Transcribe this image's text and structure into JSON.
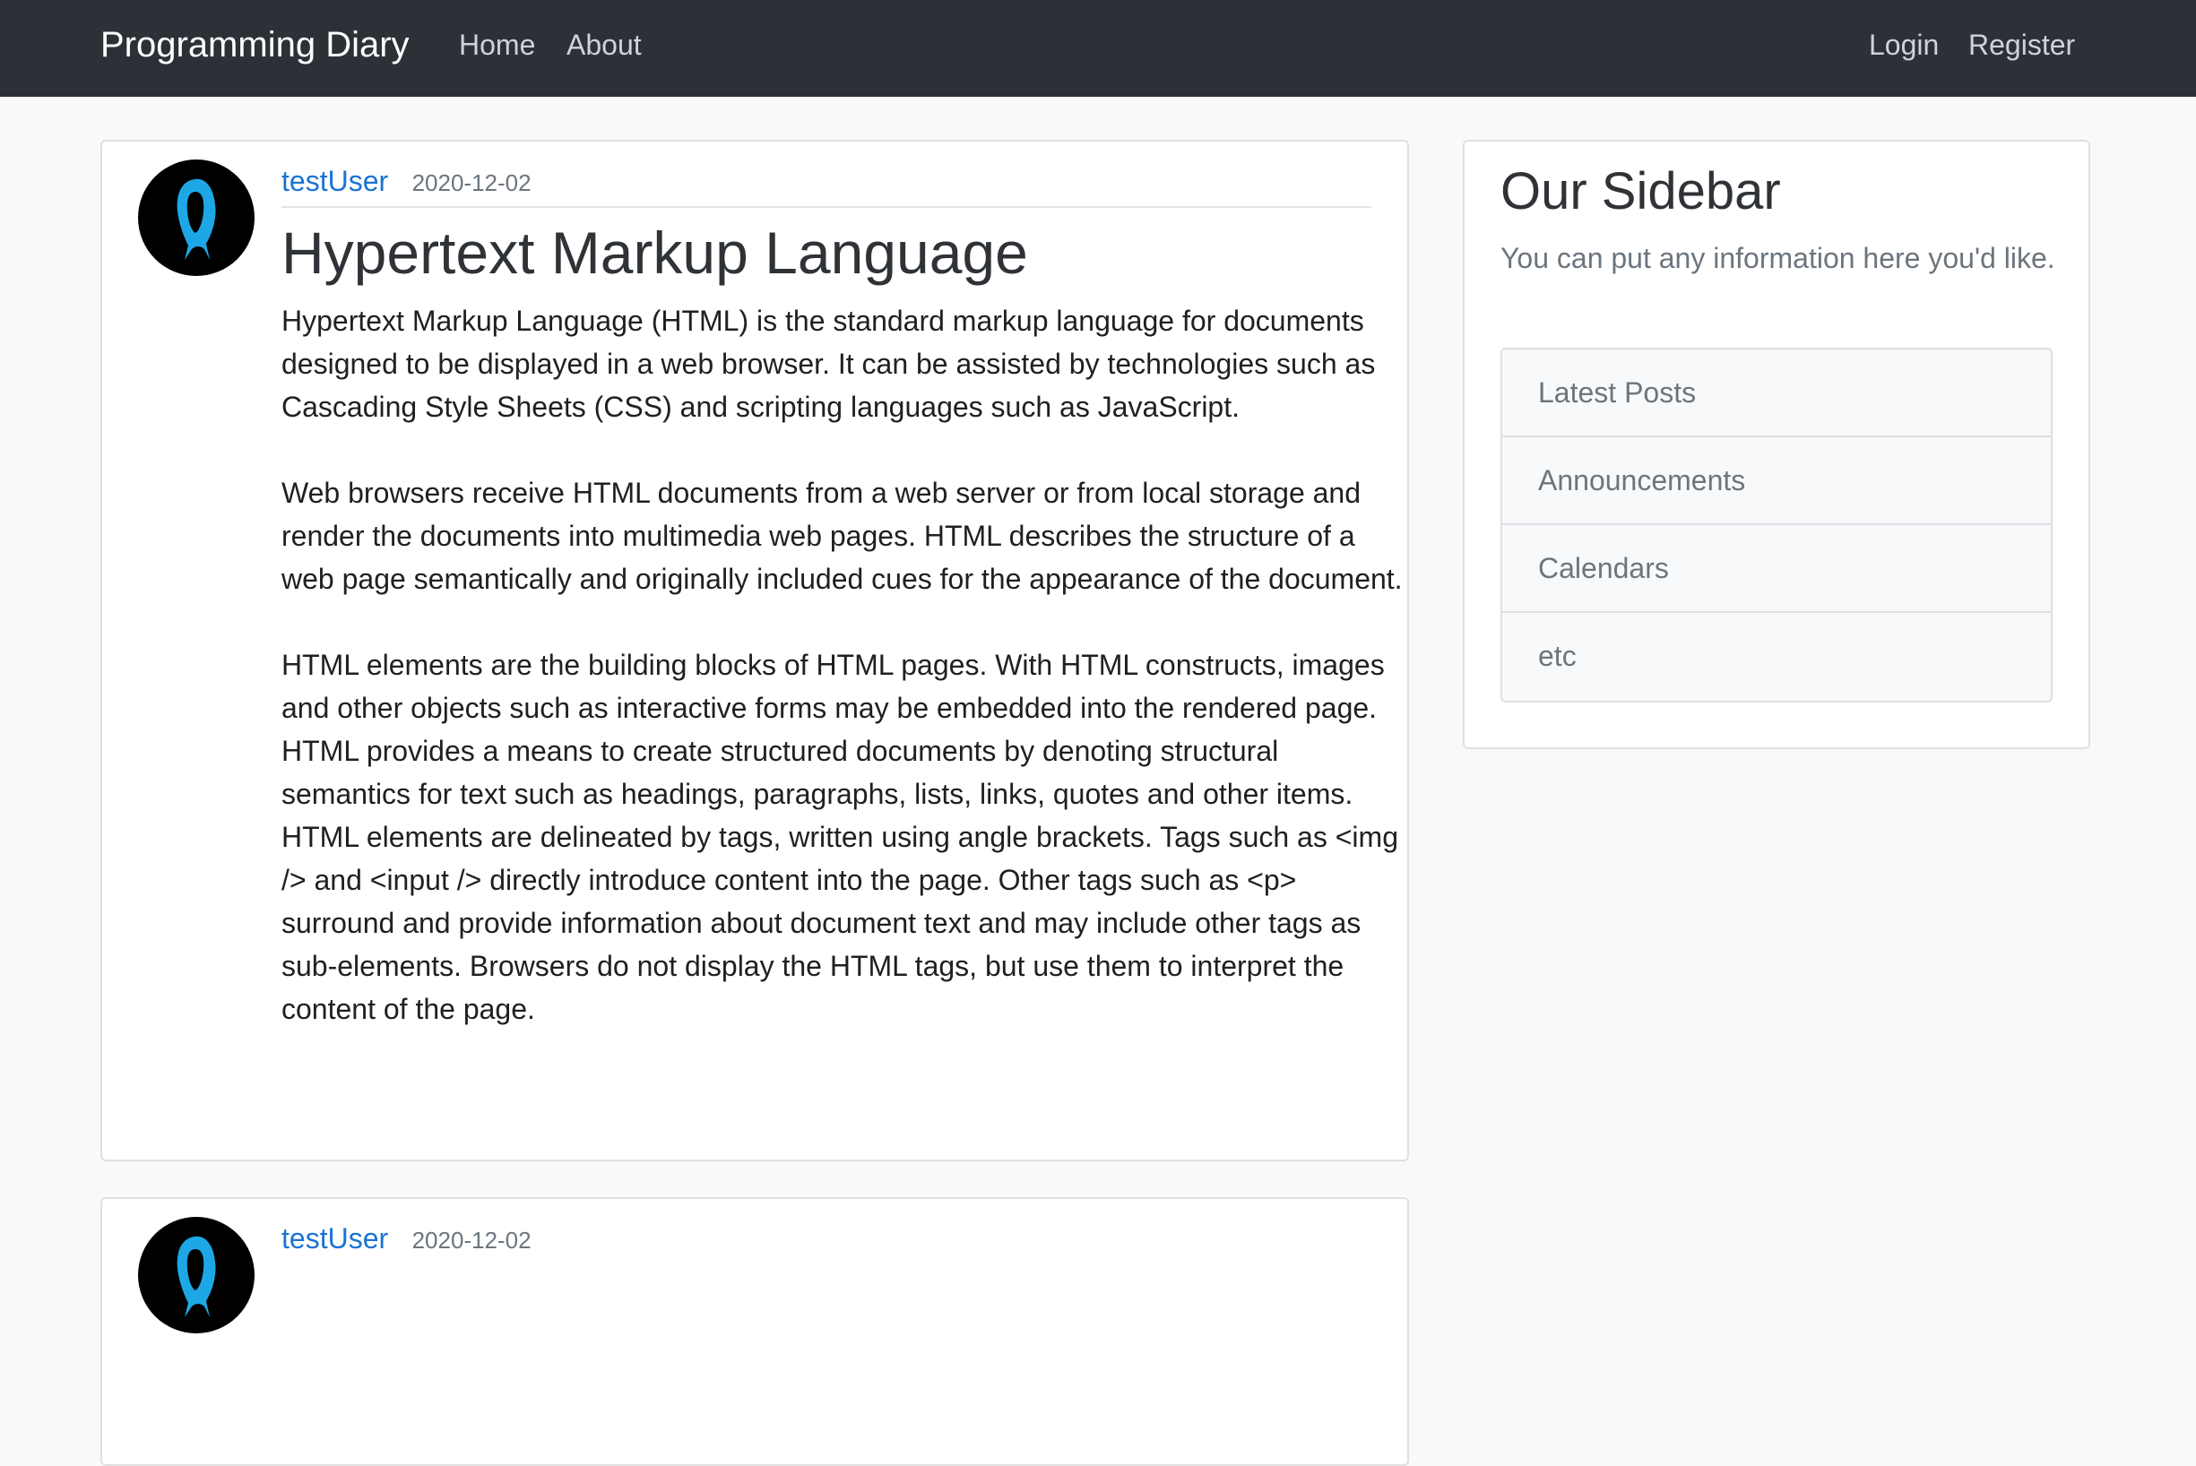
{
  "navbar": {
    "brand": "Programming Diary",
    "links": [
      "Home",
      "About"
    ],
    "auth_links": [
      "Login",
      "Register"
    ]
  },
  "posts": [
    {
      "author": "testUser",
      "date": "2020-12-02",
      "title": "Hypertext Markup Language",
      "paragraphs": [
        "Hypertext Markup Language (HTML) is the standard markup language for documents designed to be displayed in a web browser. It can be assisted by technologies such as Cascading Style Sheets (CSS) and scripting languages such as JavaScript.",
        "Web browsers receive HTML documents from a web server or from local storage and render the documents into multimedia web pages. HTML describes the structure of a web page semantically and originally included cues for the appearance of the document.",
        "HTML elements are the building blocks of HTML pages. With HTML constructs, images and other objects such as interactive forms may be embedded into the rendered page. HTML provides a means to create structured documents by denoting structural semantics for text such as headings, paragraphs, lists, links, quotes and other items. HTML elements are delineated by tags, written using angle brackets. Tags such as <img /> and <input /> directly introduce content into the page. Other tags such as <p> surround and provide information about document text and may include other tags as sub-elements. Browsers do not display the HTML tags, but use them to interpret the content of the page."
      ]
    },
    {
      "author": "testUser",
      "date": "2020-12-02"
    }
  ],
  "sidebar": {
    "title": "Our Sidebar",
    "text": "You can put any information here you'd like.",
    "items": [
      "Latest Posts",
      "Announcements",
      "Calendars",
      "etc"
    ]
  },
  "colors": {
    "navbar": "#2c3138",
    "link": "#1a73d4",
    "avatar_accent": "#1ea7e6"
  }
}
